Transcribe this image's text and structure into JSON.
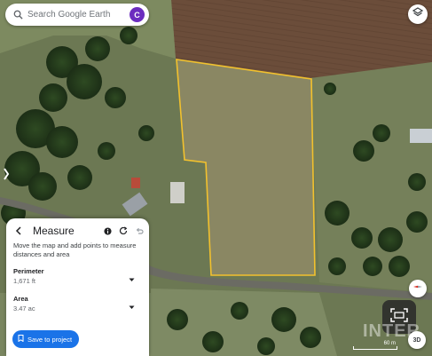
{
  "search": {
    "placeholder": "Search Google Earth",
    "avatar_letter": "C"
  },
  "measure": {
    "title": "Measure",
    "description": "Move the map and add points to measure distances and area",
    "perimeter": {
      "label": "Perimeter",
      "value": "1,671 ft"
    },
    "area": {
      "label": "Area",
      "value": "3.47 ac"
    },
    "save_label": "Save to project"
  },
  "map": {
    "scale_label": "60 m",
    "view_mode_label": "3D",
    "watermark": "INTER",
    "measure_line_color": "#f2c12e"
  },
  "icons": {
    "search": "search-icon",
    "layers": "layers-icon",
    "back": "arrow-left-icon",
    "info": "info-icon",
    "redo": "refresh-icon",
    "undo": "undo-icon",
    "compass": "compass-icon",
    "capture": "screenshot-icon",
    "project": "bookmark-icon"
  }
}
